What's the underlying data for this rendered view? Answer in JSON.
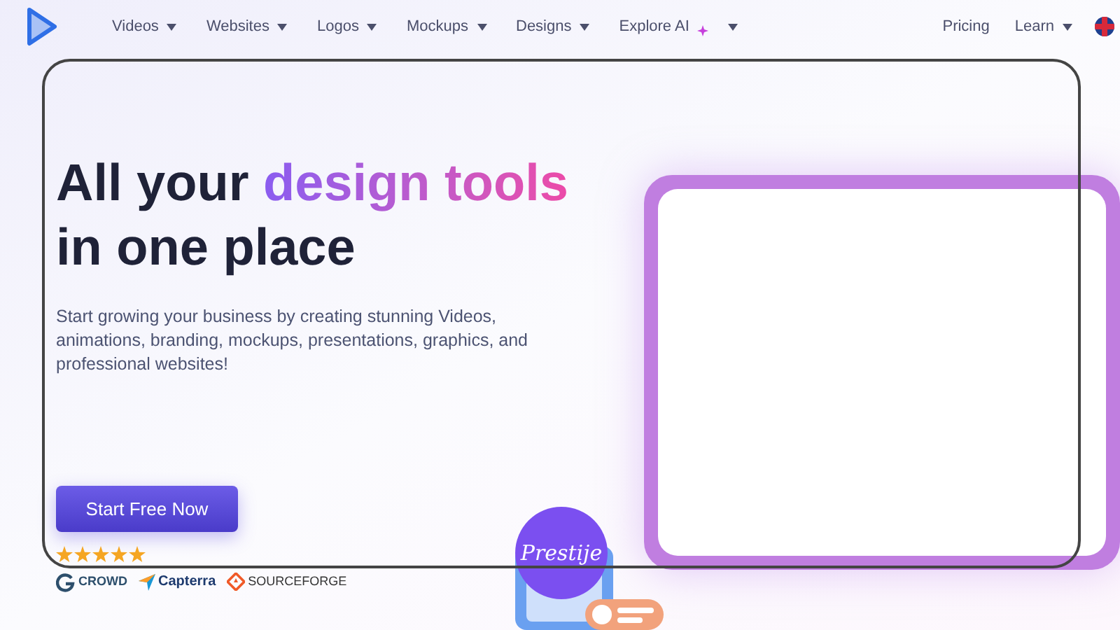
{
  "nav": {
    "items": [
      {
        "label": "Videos",
        "dropdown": true
      },
      {
        "label": "Websites",
        "dropdown": true
      },
      {
        "label": "Logos",
        "dropdown": true
      },
      {
        "label": "Mockups",
        "dropdown": true
      },
      {
        "label": "Designs",
        "dropdown": true
      },
      {
        "label": "Explore AI",
        "dropdown": true,
        "sparkle": true
      }
    ],
    "right_items": [
      {
        "label": "Pricing",
        "dropdown": false
      },
      {
        "label": "Learn",
        "dropdown": true
      }
    ]
  },
  "hero": {
    "title": [
      {
        "text": "All your ",
        "highlight": false
      },
      {
        "text": "design tools",
        "highlight": true
      },
      {
        "text": "in one place",
        "highlight": false,
        "newline": true
      }
    ],
    "subtitle": "Start growing your business by creating stunning Videos, animations, branding, mockups, presentations, graphics, and professional websites!",
    "cta": "Start Free Now",
    "stars": 5,
    "reviews": [
      {
        "kind": "g2",
        "text": "CROWD"
      },
      {
        "kind": "capterra",
        "text": "Capterra"
      },
      {
        "kind": "sourceforge",
        "text": "SOURCEFORGE"
      }
    ],
    "badge": "Prestije"
  }
}
